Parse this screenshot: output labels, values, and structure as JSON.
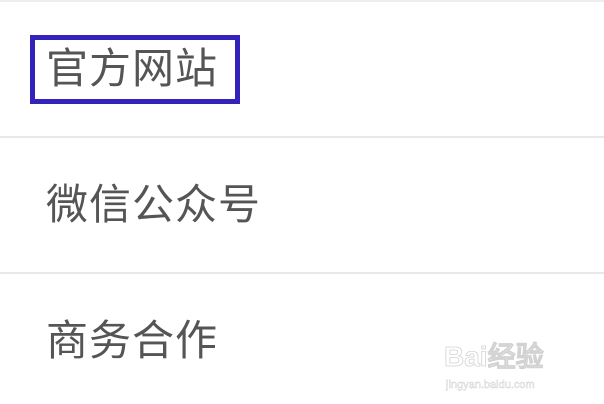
{
  "menu": {
    "items": [
      {
        "label": "官方网站",
        "highlighted": true
      },
      {
        "label": "微信公众号",
        "highlighted": false
      },
      {
        "label": "商务合作",
        "highlighted": false
      }
    ]
  },
  "watermark": {
    "brand": "Bai经验",
    "url": "jingyan.baidu.com"
  },
  "colors": {
    "highlight_border": "#3322bb",
    "text": "#555555",
    "divider": "#e8e8e8",
    "background": "#ffffff"
  }
}
